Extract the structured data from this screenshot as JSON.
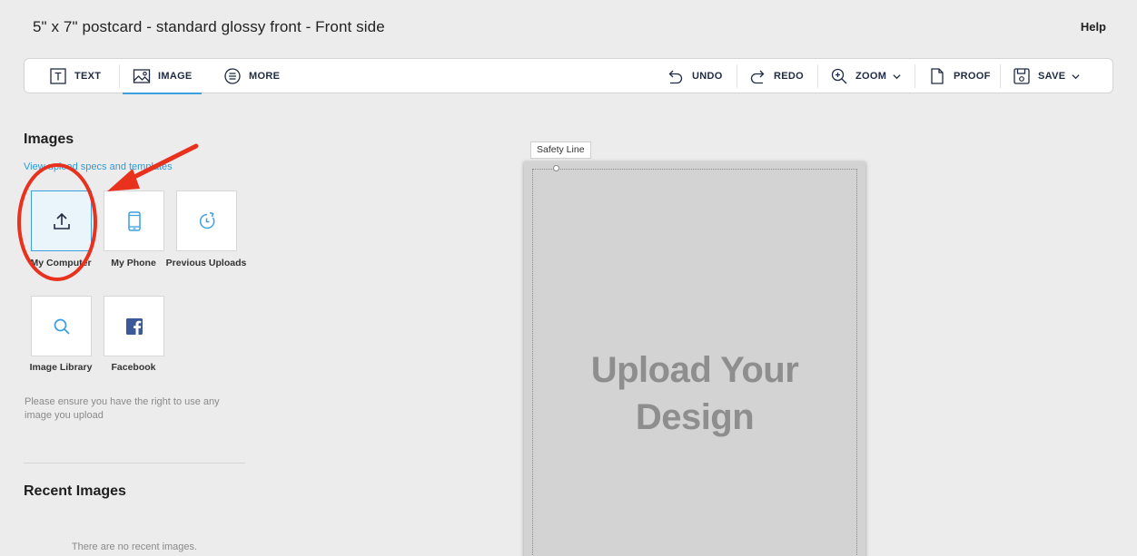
{
  "header": {
    "title": "5\" x 7\" postcard - standard glossy front - Front side",
    "help_label": "Help"
  },
  "toolbar": {
    "text_label": "TEXT",
    "image_label": "IMAGE",
    "more_label": "MORE",
    "undo_label": "UNDO",
    "redo_label": "REDO",
    "zoom_label": "ZOOM",
    "proof_label": "PROOF",
    "save_label": "SAVE"
  },
  "sidebar": {
    "images_heading": "Images",
    "specs_link": "View upload specs and templates",
    "sources": [
      {
        "label": "My Computer",
        "icon": "upload-icon"
      },
      {
        "label": "My Phone",
        "icon": "phone-icon"
      },
      {
        "label": "Previous Uploads",
        "icon": "history-icon"
      },
      {
        "label": "Image Library",
        "icon": "search-icon"
      },
      {
        "label": "Facebook",
        "icon": "facebook-icon"
      }
    ],
    "rights_note": "Please ensure you have the right to use any image you upload",
    "recent_heading": "Recent Images",
    "recent_empty": "There are no recent images."
  },
  "canvas": {
    "safety_label": "Safety Line",
    "placeholder_line1": "Upload Your",
    "placeholder_line2": "Design"
  },
  "colors": {
    "accent": "#3aa0e0",
    "annotation": "#e8321e"
  }
}
